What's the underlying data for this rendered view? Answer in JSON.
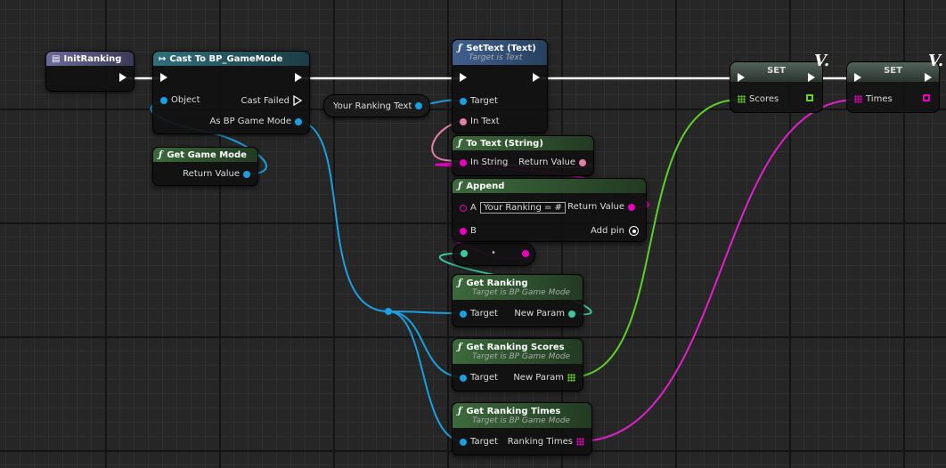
{
  "nodes": {
    "init_ranking": {
      "title": "InitRanking"
    },
    "cast": {
      "title": "Cast To BP_GameMode",
      "object": "Object",
      "cast_failed": "Cast Failed",
      "as_bp": "As BP Game Mode"
    },
    "get_game_mode": {
      "title": "Get Game Mode",
      "return_value": "Return Value"
    },
    "your_ranking_text": {
      "label": "Your Ranking Text"
    },
    "set_text": {
      "title": "SetText (Text)",
      "subtitle": "Target is Text",
      "target": "Target",
      "in_text": "In Text"
    },
    "to_text": {
      "title": "To Text (String)",
      "in_string": "In String",
      "return_value": "Return Value"
    },
    "append": {
      "title": "Append",
      "a": "A",
      "a_value": "Your Ranking = #",
      "b": "B",
      "return_value": "Return Value",
      "add_pin": "Add pin"
    },
    "convert": {
      "dot": "•"
    },
    "get_ranking": {
      "title": "Get Ranking",
      "subtitle": "Target is BP Game Mode",
      "target": "Target",
      "output": "New Param"
    },
    "get_ranking_scores": {
      "title": "Get Ranking Scores",
      "subtitle": "Target is BP Game Mode",
      "target": "Target",
      "output": "New Param"
    },
    "get_ranking_times": {
      "title": "Get Ranking Times",
      "subtitle": "Target is BP Game Mode",
      "target": "Target",
      "output": "Ranking Times"
    },
    "set_scores": {
      "title": "SET",
      "var": "Scores",
      "mark": "V."
    },
    "set_times": {
      "title": "SET",
      "var": "Times",
      "mark": "V."
    }
  },
  "icons": {
    "function": "ƒ",
    "event": "▤",
    "cast": "↦"
  },
  "colors": {
    "exec": "#ffffff",
    "object": "#1aa0e0",
    "string": "#ea00c0",
    "text": "#e080a8",
    "name": "#a0e0c8",
    "array_green": "#6ad12a",
    "array_magenta": "#ea00c0"
  }
}
